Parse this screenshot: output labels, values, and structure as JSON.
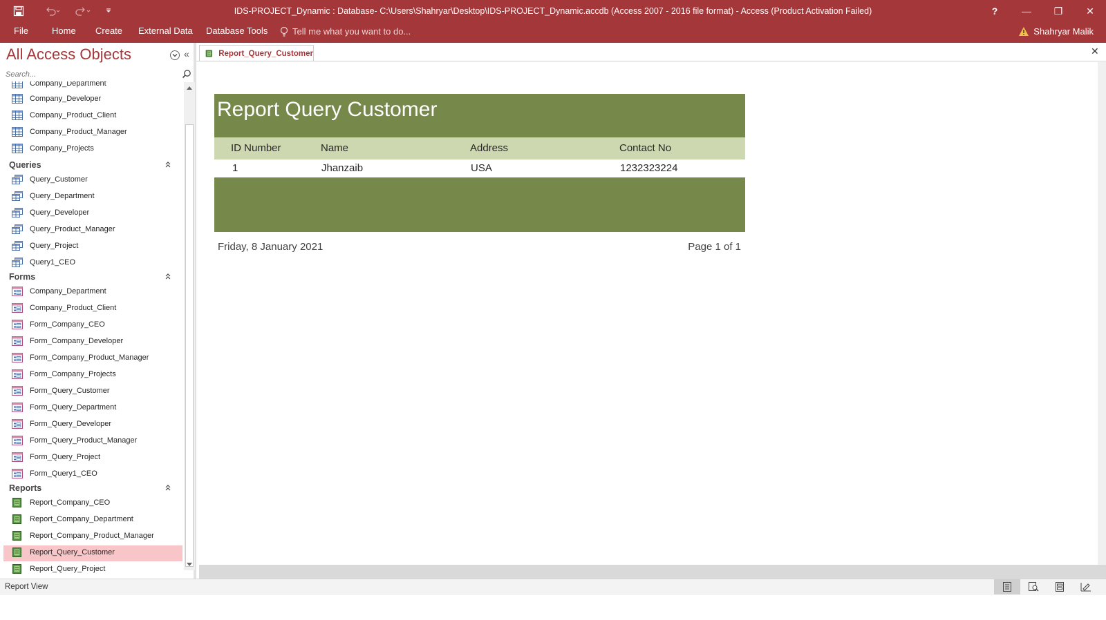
{
  "window": {
    "title": "IDS-PROJECT_Dynamic : Database- C:\\Users\\Shahryar\\Desktop\\IDS-PROJECT_Dynamic.accdb (Access 2007 - 2016 file format) - Access (Product Activation Failed)",
    "help": "?",
    "minimize": "—",
    "restore": "❐",
    "close": "✕"
  },
  "ribbon": {
    "tabs": [
      "File",
      "Home",
      "Create",
      "External Data",
      "Database Tools"
    ],
    "tell_me": "Tell me what you want to do...",
    "user": "Shahryar Malik"
  },
  "nav": {
    "title": "All Access Objects",
    "collapse": "«",
    "search_placeholder": "Search...",
    "tables": [
      "Company_Department",
      "Company_Developer",
      "Company_Product_Client",
      "Company_Product_Manager",
      "Company_Projects"
    ],
    "queries_label": "Queries",
    "queries": [
      "Query_Customer",
      "Query_Department",
      "Query_Developer",
      "Query_Product_Manager",
      "Query_Project",
      "Query1_CEO"
    ],
    "forms_label": "Forms",
    "forms": [
      "Company_Department",
      "Company_Product_Client",
      "Form_Company_CEO",
      "Form_Company_Developer",
      "Form_Company_Product_Manager",
      "Form_Company_Projects",
      "Form_Query_Customer",
      "Form_Query_Department",
      "Form_Query_Developer",
      "Form_Query_Product_Manager",
      "Form_Query_Project",
      "Form_Query1_CEO"
    ],
    "reports_label": "Reports",
    "reports": [
      "Report_Company_CEO",
      "Report_Company_Department",
      "Report_Company_Product_Manager",
      "Report_Query_Customer",
      "Report_Query_Project"
    ],
    "selected_report": "Report_Query_Customer"
  },
  "document": {
    "tab_label": "Report_Query_Customer",
    "close": "✕"
  },
  "report": {
    "title": "Report Query Customer",
    "columns": [
      "ID Number",
      "Name",
      "Address",
      "Contact No"
    ],
    "rows": [
      [
        "1",
        "Jhanzaib",
        "USA",
        "1232323224"
      ]
    ],
    "date": "Friday, 8 January 2021",
    "page": "Page 1 of 1"
  },
  "status": {
    "text": "Report View"
  },
  "colors": {
    "accent": "#a4373a",
    "report_header": "#76894a",
    "report_columns": "#ced8b0",
    "selected_row": "#f8c6c8"
  }
}
